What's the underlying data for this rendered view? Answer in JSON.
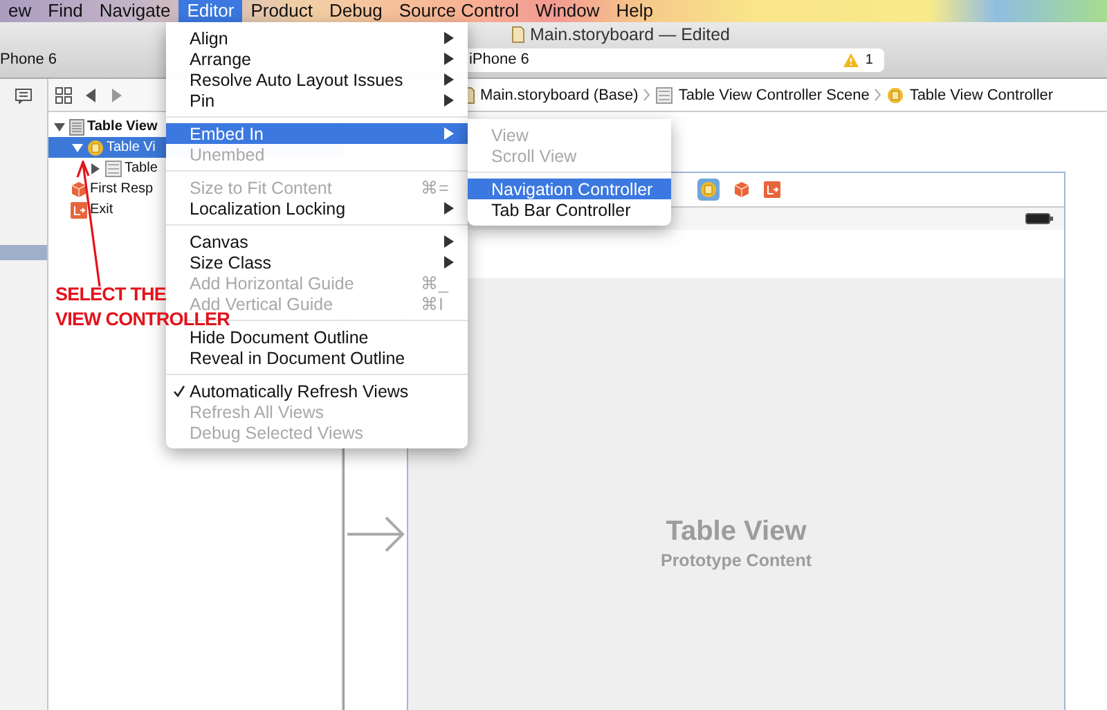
{
  "menu_bar": [
    {
      "label": "ew",
      "selected": false
    },
    {
      "label": "Find",
      "selected": false
    },
    {
      "label": "Navigate",
      "selected": false
    },
    {
      "label": "Editor",
      "selected": true
    },
    {
      "label": "Product",
      "selected": false
    },
    {
      "label": "Debug",
      "selected": false
    },
    {
      "label": "Source Control",
      "selected": false
    },
    {
      "label": "Window",
      "selected": false
    },
    {
      "label": "Help",
      "selected": false
    }
  ],
  "window": {
    "title": "Main.storyboard — Edited"
  },
  "toolbar": {
    "device_label": "Phone 6",
    "scheme": "iPhone 6",
    "warning_count": "1"
  },
  "breadcrumb": [
    {
      "label": "Main.storyboard (Base)",
      "kind": "file"
    },
    {
      "label": "Table View Controller Scene",
      "kind": "scene"
    },
    {
      "label": "Table View Controller",
      "kind": "controller"
    }
  ],
  "outline": [
    {
      "label": "Table View",
      "kind": "scene",
      "expanded": true,
      "selected": false,
      "children": [
        {
          "label": "Table Vi",
          "kind": "controller",
          "expanded": true,
          "selected": true,
          "children": [
            {
              "label": "Table",
              "kind": "table",
              "expanded": false,
              "selected": false
            }
          ]
        },
        {
          "label": "First Resp",
          "kind": "responder",
          "selected": false
        },
        {
          "label": "Exit",
          "kind": "exit",
          "selected": false
        }
      ]
    }
  ],
  "canvas": {
    "title": "Table View",
    "subtitle": "Prototype Content"
  },
  "annotation": {
    "lines": [
      "SELECT THE",
      "VIEW CONTROLLER"
    ]
  },
  "editor_menu": [
    {
      "kind": "item",
      "label": "Align",
      "submenu": true,
      "disabled": false,
      "selected": false,
      "checked": false
    },
    {
      "kind": "item",
      "label": "Arrange",
      "submenu": true,
      "disabled": false,
      "selected": false,
      "checked": false
    },
    {
      "kind": "item",
      "label": "Resolve Auto Layout Issues",
      "submenu": true,
      "disabled": false,
      "selected": false,
      "checked": false
    },
    {
      "kind": "item",
      "label": "Pin",
      "submenu": true,
      "disabled": false,
      "selected": false,
      "checked": false
    },
    {
      "kind": "separator"
    },
    {
      "kind": "item",
      "label": "Embed In",
      "submenu": true,
      "disabled": false,
      "selected": true,
      "checked": false
    },
    {
      "kind": "item",
      "label": "Unembed",
      "submenu": false,
      "disabled": true,
      "selected": false,
      "checked": false
    },
    {
      "kind": "separator"
    },
    {
      "kind": "item",
      "label": "Size to Fit Content",
      "shortcut": "⌘=",
      "submenu": false,
      "disabled": true,
      "selected": false,
      "checked": false
    },
    {
      "kind": "item",
      "label": "Localization Locking",
      "submenu": true,
      "disabled": false,
      "selected": false,
      "checked": false
    },
    {
      "kind": "separator"
    },
    {
      "kind": "item",
      "label": "Canvas",
      "submenu": true,
      "disabled": false,
      "selected": false,
      "checked": false
    },
    {
      "kind": "item",
      "label": "Size Class",
      "submenu": true,
      "disabled": false,
      "selected": false,
      "checked": false
    },
    {
      "kind": "item",
      "label": "Add Horizontal Guide",
      "shortcut": "⌘_",
      "submenu": false,
      "disabled": true,
      "selected": false,
      "checked": false
    },
    {
      "kind": "item",
      "label": "Add Vertical Guide",
      "shortcut": "⌘I",
      "submenu": false,
      "disabled": true,
      "selected": false,
      "checked": false
    },
    {
      "kind": "separator"
    },
    {
      "kind": "item",
      "label": "Hide Document Outline",
      "submenu": false,
      "disabled": false,
      "selected": false,
      "checked": false
    },
    {
      "kind": "item",
      "label": "Reveal in Document Outline",
      "submenu": false,
      "disabled": false,
      "selected": false,
      "checked": false
    },
    {
      "kind": "separator"
    },
    {
      "kind": "item",
      "label": "Automatically Refresh Views",
      "submenu": false,
      "disabled": false,
      "selected": false,
      "checked": true
    },
    {
      "kind": "item",
      "label": "Refresh All Views",
      "submenu": false,
      "disabled": true,
      "selected": false,
      "checked": false
    },
    {
      "kind": "item",
      "label": "Debug Selected Views",
      "submenu": false,
      "disabled": true,
      "selected": false,
      "checked": false
    }
  ],
  "embed_submenu": [
    {
      "kind": "item",
      "label": "View",
      "submenu": false,
      "disabled": true,
      "selected": false,
      "checked": false
    },
    {
      "kind": "item",
      "label": "Scroll View",
      "submenu": false,
      "disabled": true,
      "selected": false,
      "checked": false
    },
    {
      "kind": "separator"
    },
    {
      "kind": "item",
      "label": "Navigation Controller",
      "submenu": false,
      "disabled": false,
      "selected": true,
      "checked": false
    },
    {
      "kind": "item",
      "label": "Tab Bar Controller",
      "submenu": false,
      "disabled": false,
      "selected": false,
      "checked": false
    }
  ]
}
